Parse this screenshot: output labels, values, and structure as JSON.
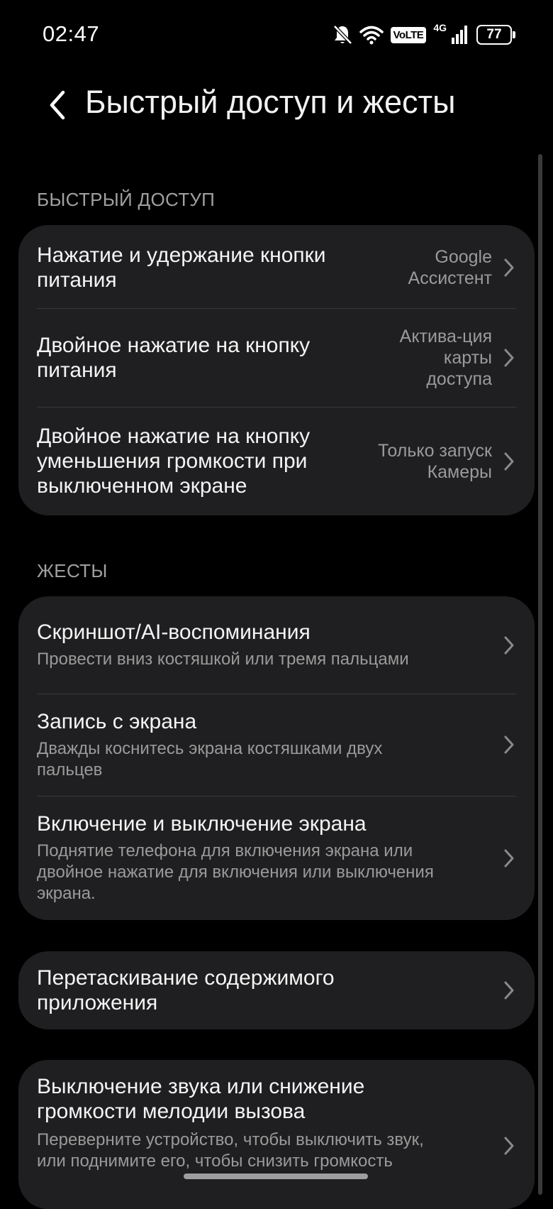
{
  "status_bar": {
    "time": "02:47",
    "volte": "VoLTE",
    "network": "4G",
    "battery": "77",
    "icons": [
      "bell-off-icon",
      "wifi-icon",
      "volte-icon",
      "signal-icon",
      "battery-icon"
    ]
  },
  "header": {
    "title": "Быстрый доступ и жесты",
    "back_icon": "back-arrow-icon"
  },
  "sections": {
    "quick_access": {
      "label": "БЫСТРЫЙ ДОСТУП",
      "items": [
        {
          "title": "Нажатие и удержание кнопки питания",
          "value": "Google Ассистент"
        },
        {
          "title": "Двойное нажатие на кнопку питания",
          "value": "Актива-ция карты доступа"
        },
        {
          "title": "Двойное нажатие на кнопку уменьшения громкости при выключенном экране",
          "value": "Только запуск Камеры"
        }
      ]
    },
    "gestures": {
      "label": "ЖЕСТЫ",
      "items": [
        {
          "title": "Скриншот/AI-воспоминания",
          "subtitle": "Провести вниз костяшкой или тремя пальцами"
        },
        {
          "title": "Запись с экрана",
          "subtitle": "Дважды коснитесь экрана костяшками двух пальцев"
        },
        {
          "title": "Включение и выключение экрана",
          "subtitle": "Поднятие телефона для включения экрана или двойное нажатие для включения или выключения экрана."
        }
      ]
    },
    "drag": {
      "items": [
        {
          "title": "Перетаскивание содержимого приложения"
        }
      ]
    },
    "mute": {
      "items": [
        {
          "title": "Выключение звука или снижение громкости мелодии вызова",
          "subtitle": "Переверните устройство, чтобы выключить звук, или поднимите его, чтобы снизить громкость"
        }
      ]
    }
  },
  "colors": {
    "background": "#000000",
    "card": "#1f1f21",
    "primary_text": "#f4f4f4",
    "secondary_text": "#9a9a9a"
  }
}
